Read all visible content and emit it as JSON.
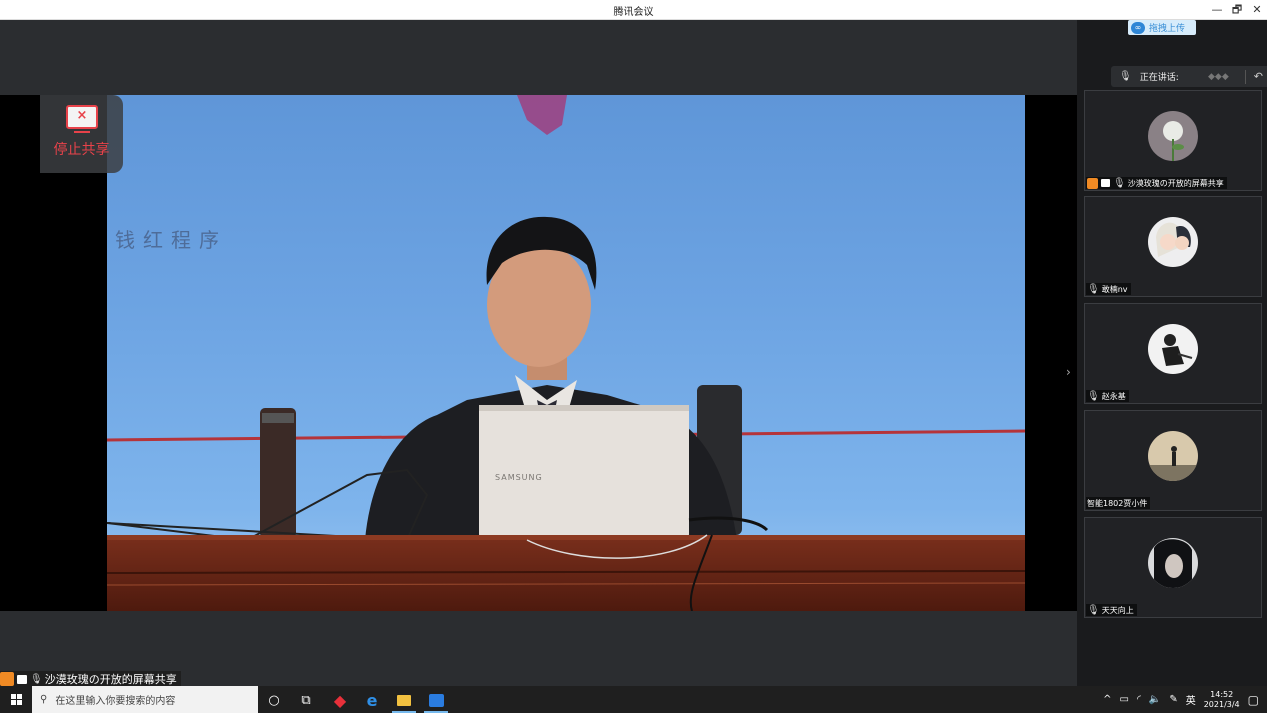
{
  "window": {
    "title": "腾讯会议",
    "minimize": "—",
    "maximize": "🗗",
    "close": "✕"
  },
  "stop_share": {
    "label": "停止共享",
    "x": "×"
  },
  "shared_caption": "沙漠玫瑰の开放的屏幕共享",
  "sidebar": {
    "upload_label": "拖拽上传",
    "speaking_label": "正在讲话:",
    "participants": [
      {
        "name": "沙漠玫瑰の开放的屏幕共享",
        "host": true,
        "sharing": true
      },
      {
        "name": "敢楠nv",
        "host": false,
        "sharing": false
      },
      {
        "name": "赵永基",
        "host": false,
        "sharing": false
      },
      {
        "name": "智能1802贾小件",
        "host": false,
        "sharing": false
      },
      {
        "name": "天天向上",
        "host": false,
        "sharing": false
      }
    ]
  },
  "video": {
    "laptop_brand": "SAMSUNG",
    "banner_text": "钱红程序"
  },
  "taskbar": {
    "search_placeholder": "在这里输入你要搜索的内容",
    "ime": "英",
    "time": "14:52",
    "date": "2021/3/4"
  },
  "colors": {
    "accent_red": "#e8424a",
    "accent_blue": "#2f86d6",
    "host_orange": "#f08a24"
  }
}
